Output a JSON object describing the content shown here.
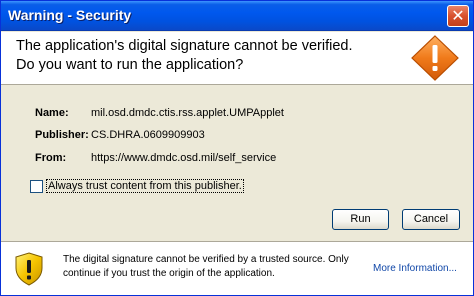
{
  "window": {
    "title": "Warning - Security",
    "close_glyph": "✕"
  },
  "header": {
    "line1": "The application's digital signature cannot be verified.",
    "line2": "Do you want to run the application?",
    "icon": "warning-diamond-icon"
  },
  "details": [
    {
      "label": "Name:",
      "value": "mil.osd.dmdc.ctis.rss.applet.UMPApplet"
    },
    {
      "label": "Publisher:",
      "value": "CS.DHRA.0609909903"
    },
    {
      "label": "From:",
      "value": "https://www.dmdc.osd.mil/self_service"
    }
  ],
  "trust": {
    "label": "Always trust content from this publisher.",
    "checked": false
  },
  "buttons": {
    "run": "Run",
    "cancel": "Cancel"
  },
  "footer": {
    "icon": "shield-warning-icon",
    "text": "The digital signature cannot be verified by a trusted source.  Only continue if you trust the origin of the application.",
    "more_info": "More Information..."
  },
  "colors": {
    "titlebar": "#0058ee",
    "warning_orange": "#f07a1a",
    "shield_yellow": "#f5c400",
    "link": "#1047a8"
  }
}
